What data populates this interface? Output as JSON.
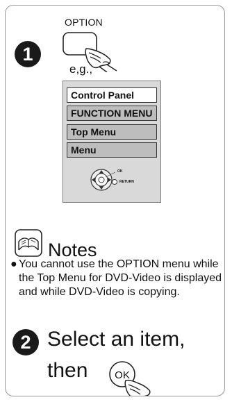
{
  "step1": {
    "number": "1",
    "option_label": "OPTION",
    "eg_label": "e,g.,"
  },
  "panel": {
    "title": "Control Panel",
    "items": [
      "FUNCTION MENU",
      "Top Menu",
      "Menu"
    ],
    "ok_label": "OK",
    "return_label": "RETURN"
  },
  "notes": {
    "title": "Notes",
    "bullet": "You cannot use the OPTION menu while the Top Menu for DVD-Video is displayed and while DVD-Video is copying."
  },
  "step2": {
    "number": "2",
    "line1": "Select an item,",
    "line2": "then",
    "ok_button_label": "OK"
  }
}
